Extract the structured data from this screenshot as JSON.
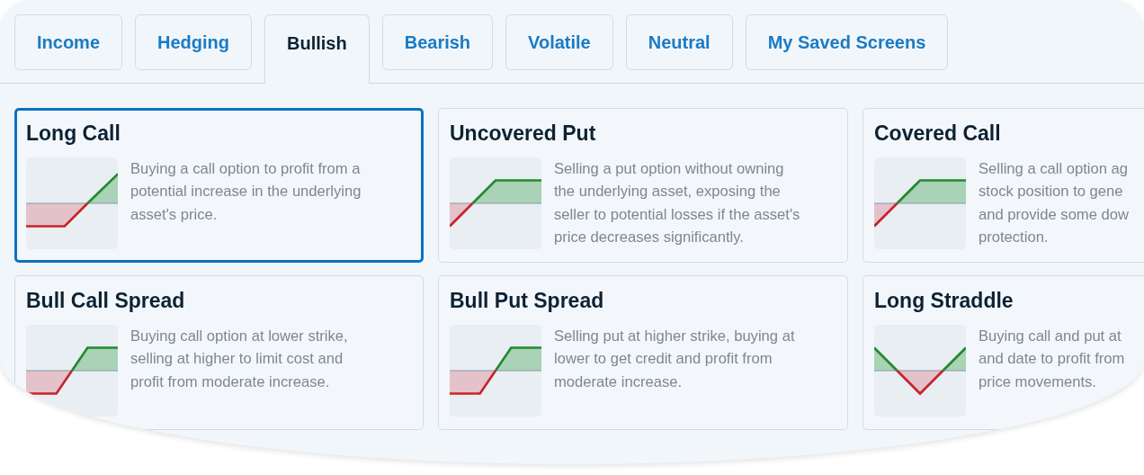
{
  "tabs": [
    {
      "label": "Income",
      "selected": false
    },
    {
      "label": "Hedging",
      "selected": false
    },
    {
      "label": "Bullish",
      "selected": true
    },
    {
      "label": "Bearish",
      "selected": false
    },
    {
      "label": "Volatile",
      "selected": false
    },
    {
      "label": "Neutral",
      "selected": false
    },
    {
      "label": "My Saved Screens",
      "selected": false
    }
  ],
  "strategies": [
    {
      "title": "Long Call",
      "kind": "long-call",
      "selected": true,
      "description_lines": [
        "Buying a call option to profit from a",
        "potential increase in the underlying",
        "asset's price."
      ]
    },
    {
      "title": "Uncovered Put",
      "kind": "uncovered-put",
      "selected": false,
      "description_lines": [
        "Selling a put option without owning",
        "the underlying asset, exposing the",
        "seller to potential losses if the asset's",
        "price decreases significantly."
      ]
    },
    {
      "title": "Covered Call",
      "kind": "covered-call",
      "selected": false,
      "description_lines": [
        "Selling a call option ag",
        "stock position to gene",
        "and provide some dow",
        "protection."
      ]
    },
    {
      "title": "Bull Call Spread",
      "kind": "bull-call-spread",
      "selected": false,
      "description_lines": [
        "Buying call option at lower strike,",
        "selling at higher to limit cost and",
        "profit from moderate increase."
      ]
    },
    {
      "title": "Bull Put Spread",
      "kind": "bull-put-spread",
      "selected": false,
      "description_lines": [
        "Selling put at higher strike, buying at",
        "lower to get credit and profit from",
        "moderate increase."
      ]
    },
    {
      "title": "Long Straddle",
      "kind": "long-straddle",
      "selected": false,
      "description_lines": [
        "Buying call and put at",
        "and date to profit from",
        "price movements."
      ]
    }
  ]
}
